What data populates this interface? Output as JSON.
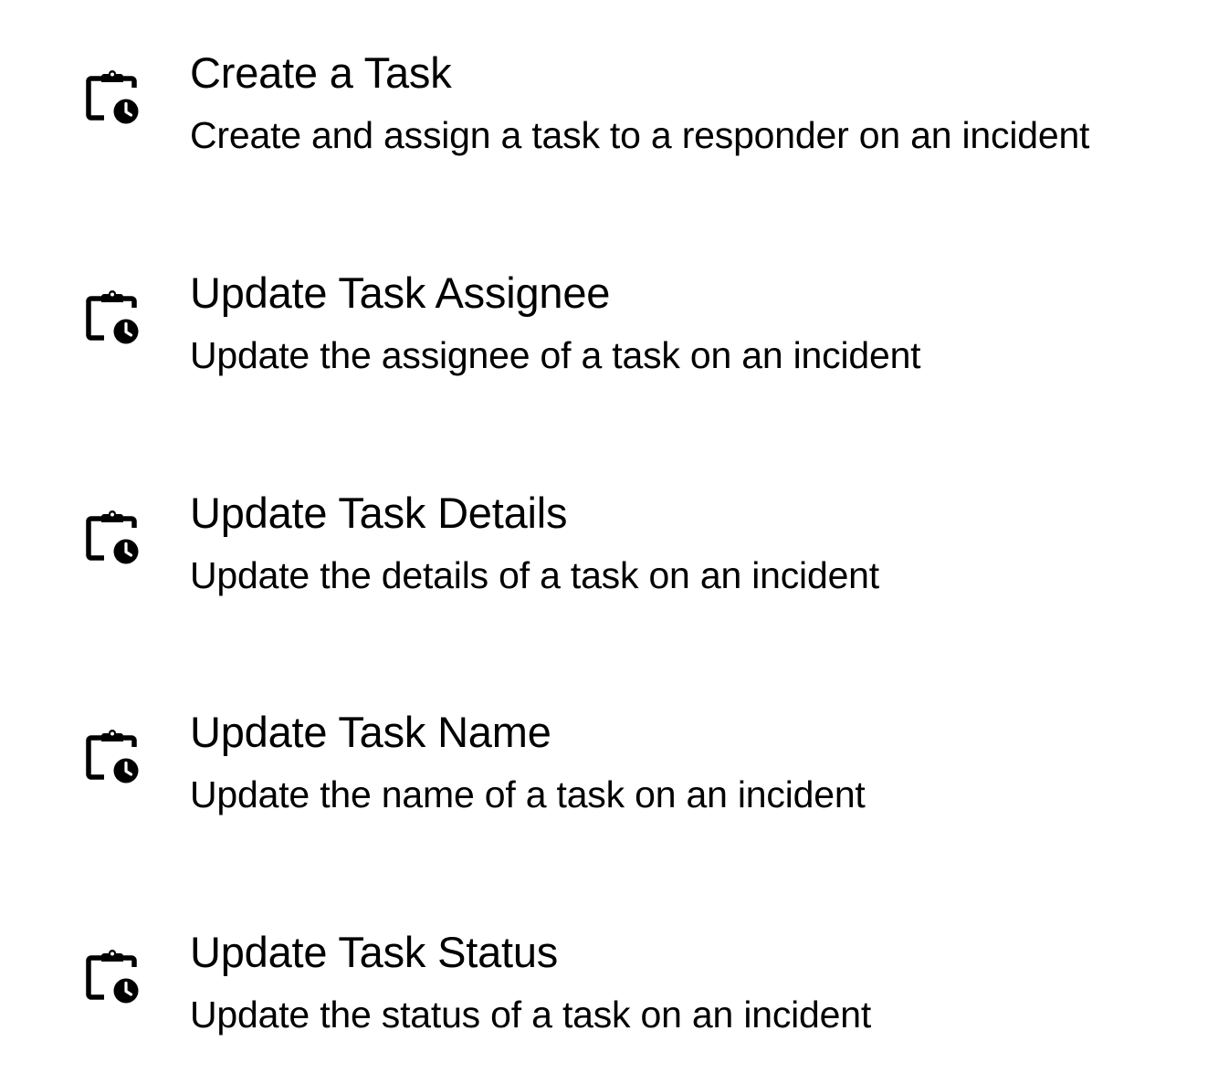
{
  "actions": [
    {
      "icon": "clipboard-clock-icon",
      "title": "Create a Task",
      "description": "Create and assign a task to a responder on an incident"
    },
    {
      "icon": "clipboard-clock-icon",
      "title": "Update Task Assignee",
      "description": "Update the assignee of a task on an incident"
    },
    {
      "icon": "clipboard-clock-icon",
      "title": "Update Task Details",
      "description": "Update the details of a task on an incident"
    },
    {
      "icon": "clipboard-clock-icon",
      "title": "Update Task Name",
      "description": "Update the name of a task on an incident"
    },
    {
      "icon": "clipboard-clock-icon",
      "title": "Update Task Status",
      "description": "Update the status of a task on an incident"
    }
  ]
}
